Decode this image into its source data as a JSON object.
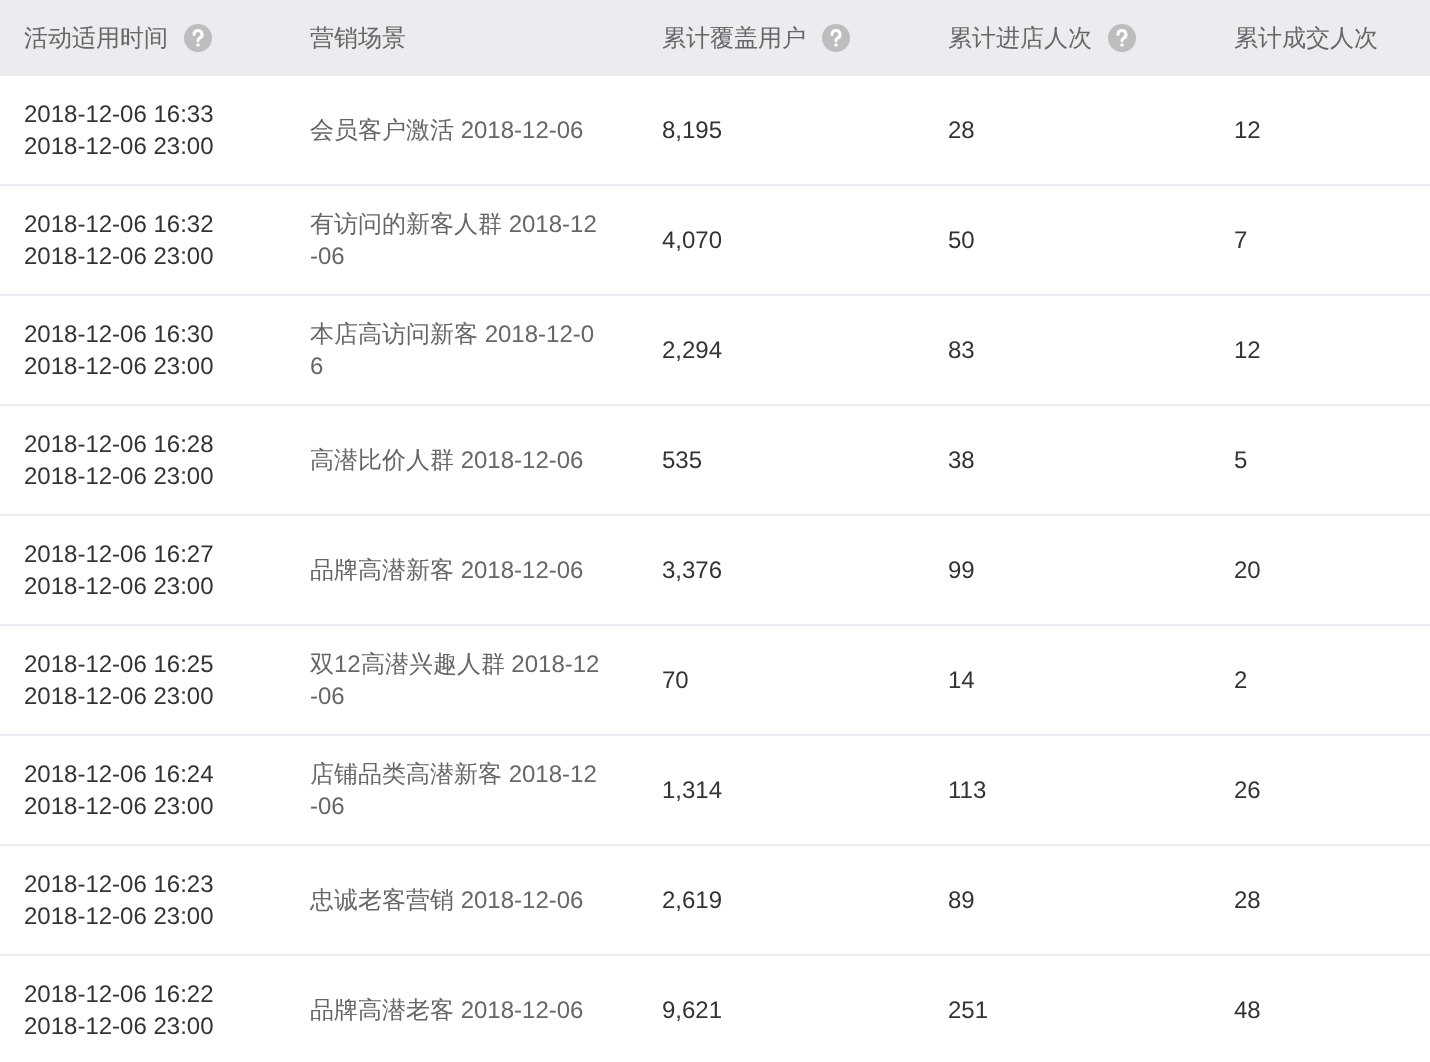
{
  "table": {
    "columns": [
      {
        "label": "活动适用时间",
        "help": true
      },
      {
        "label": "营销场景",
        "help": false
      },
      {
        "label": "累计覆盖用户",
        "help": true
      },
      {
        "label": "累计进店人次",
        "help": true
      },
      {
        "label": "累计成交人次",
        "help": false
      }
    ],
    "rows": [
      {
        "start": "2018-12-06 16:33",
        "end": "2018-12-06 23:00",
        "scene": "会员客户激活 2018-12-06",
        "users": "8,195",
        "visits": "28",
        "deals": "12"
      },
      {
        "start": "2018-12-06 16:32",
        "end": "2018-12-06 23:00",
        "scene": "有访问的新客人群 2018-12-06",
        "users": "4,070",
        "visits": "50",
        "deals": "7"
      },
      {
        "start": "2018-12-06 16:30",
        "end": "2018-12-06 23:00",
        "scene": "本店高访问新客 2018-12-06",
        "users": "2,294",
        "visits": "83",
        "deals": "12"
      },
      {
        "start": "2018-12-06 16:28",
        "end": "2018-12-06 23:00",
        "scene": "高潜比价人群 2018-12-06",
        "users": "535",
        "visits": "38",
        "deals": "5"
      },
      {
        "start": "2018-12-06 16:27",
        "end": "2018-12-06 23:00",
        "scene": "品牌高潜新客 2018-12-06",
        "users": "3,376",
        "visits": "99",
        "deals": "20"
      },
      {
        "start": "2018-12-06 16:25",
        "end": "2018-12-06 23:00",
        "scene": "双12高潜兴趣人群 2018-12-06",
        "users": "70",
        "visits": "14",
        "deals": "2"
      },
      {
        "start": "2018-12-06 16:24",
        "end": "2018-12-06 23:00",
        "scene": "店铺品类高潜新客 2018-12-06",
        "users": "1,314",
        "visits": "113",
        "deals": "26"
      },
      {
        "start": "2018-12-06 16:23",
        "end": "2018-12-06 23:00",
        "scene": "忠诚老客营销 2018-12-06",
        "users": "2,619",
        "visits": "89",
        "deals": "28"
      },
      {
        "start": "2018-12-06 16:22",
        "end": "2018-12-06 23:00",
        "scene": "品牌高潜老客 2018-12-06",
        "users": "9,621",
        "visits": "251",
        "deals": "48"
      }
    ]
  }
}
